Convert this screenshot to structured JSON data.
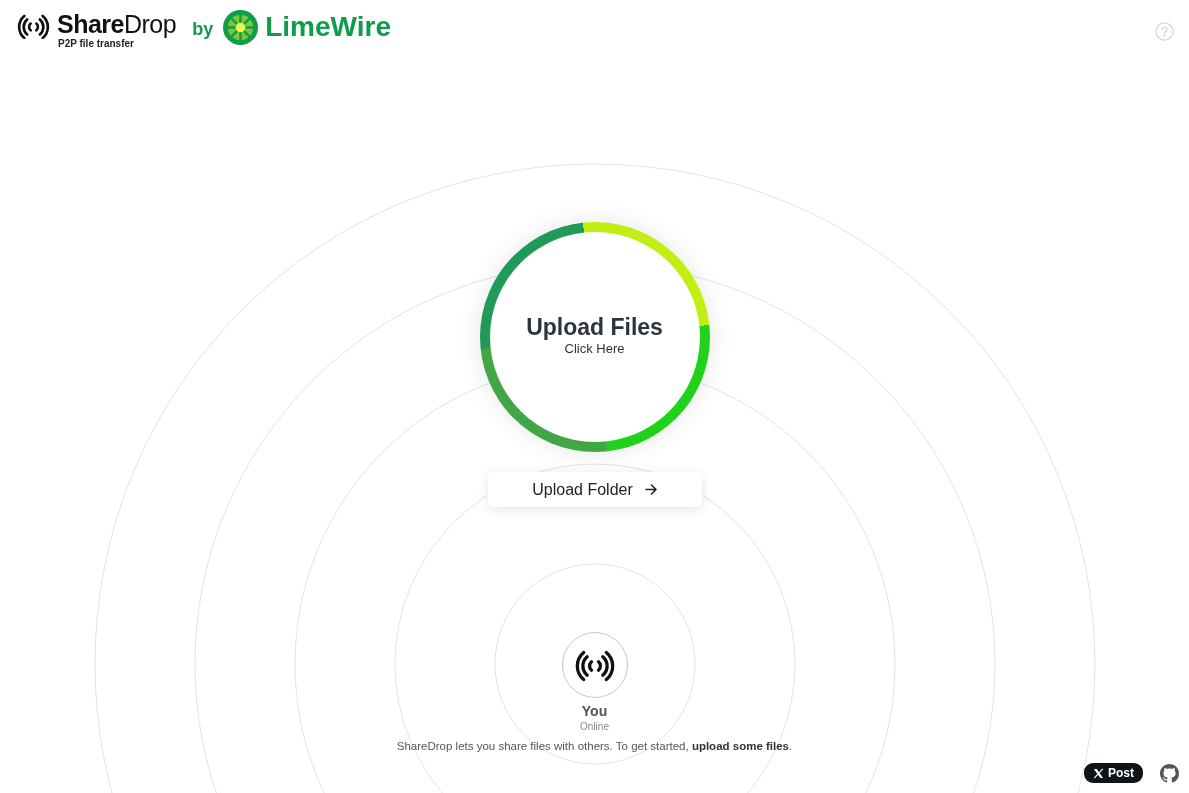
{
  "header": {
    "wordmark": "**Share**Drop",
    "tagline": "P2P file transfer",
    "by": "by",
    "partner": "LimeWire"
  },
  "upload": {
    "title": "Upload Files",
    "subtitle": "Click Here",
    "folder_button": "Upload Folder"
  },
  "peer": {
    "name": "You",
    "status": "Online"
  },
  "intro": "ShareDrop lets you share files with others. To get started, **upload some files**.",
  "footer": {
    "post_button": "Post"
  }
}
